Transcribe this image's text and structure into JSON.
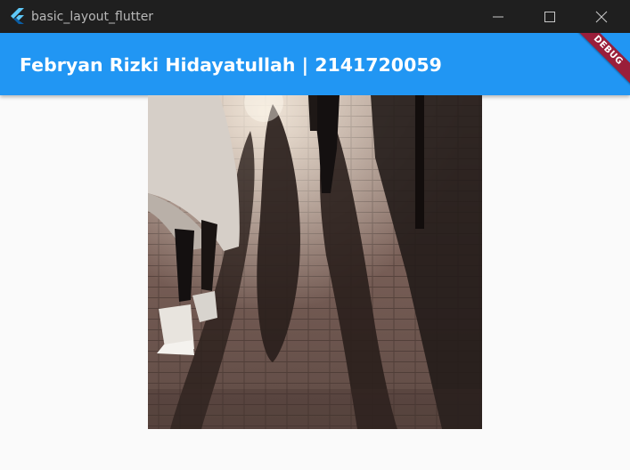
{
  "window": {
    "title": "basic_layout_flutter",
    "icon": "flutter-logo-icon",
    "controls": [
      "minimize-icon",
      "maximize-icon",
      "close-icon"
    ]
  },
  "appbar": {
    "title": "Febryan Rizki Hidayatullah | 2141720059",
    "color": "#2196f3"
  },
  "debug_banner": {
    "label": "DEBUG",
    "color": "#9a1e3a"
  },
  "photo": {
    "description_icon": "sidewalk-shadows-photo"
  }
}
